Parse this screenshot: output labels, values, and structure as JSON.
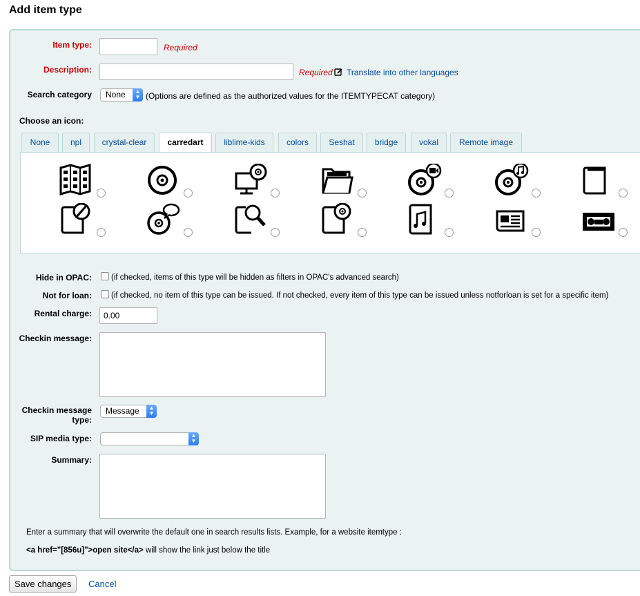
{
  "page": {
    "title": "Add item type"
  },
  "form": {
    "item_type": {
      "label": "Item type:",
      "value": "",
      "required_text": "Required"
    },
    "description": {
      "label": "Description:",
      "value": "",
      "required_text": "Required",
      "translate_link": "Translate into other languages"
    },
    "search_category": {
      "label": "Search category",
      "selected": "None",
      "note": "(Options are defined as the authorized values for the ITEMTYPECAT category)"
    },
    "choose_icon": {
      "label": "Choose an icon:"
    },
    "hide_in_opac": {
      "label": "Hide in OPAC:",
      "checked": false,
      "note": "(if checked, items of this type will be hidden as filters in OPAC's advanced search)"
    },
    "not_for_loan": {
      "label": "Not for loan:",
      "checked": false,
      "note": "(if checked, no item of this type can be issued. If not checked, every item of this type can be issued unless notforloan is set for a specific item)"
    },
    "rental_charge": {
      "label": "Rental charge:",
      "value": "0.00"
    },
    "checkin_message": {
      "label": "Checkin message:",
      "value": ""
    },
    "checkin_message_type": {
      "label_line1": "Checkin message",
      "label_line2": "type:",
      "selected": "Message"
    },
    "sip_media_type": {
      "label": "SIP media type:",
      "selected": ""
    },
    "summary": {
      "label": "Summary:",
      "value": "",
      "help_line1": "Enter a summary that will overwrite the default one in search results lists. Example, for a website itemtype :",
      "help_code": "<a href=\"[856u]\">open site</a>",
      "help_line2_rest": " will show the link just below the title"
    }
  },
  "icon_tabs": [
    {
      "label": "None"
    },
    {
      "label": "npl"
    },
    {
      "label": "crystal-clear"
    },
    {
      "label": "carredart",
      "active": true
    },
    {
      "label": "liblime-kids"
    },
    {
      "label": "colors"
    },
    {
      "label": "Seshat"
    },
    {
      "label": "bridge"
    },
    {
      "label": "vokal"
    },
    {
      "label": "Remote image"
    }
  ],
  "icons": [
    "map-icon",
    "cd-icon",
    "computer-disc-icon",
    "folder-icon",
    "video-disc-icon",
    "music-disc-icon",
    "book-icon",
    "art-book-icon",
    "speech-disc-icon",
    "book-search-icon",
    "book-disc-icon",
    "music-book-icon",
    "newspaper-icon",
    "vhs-icon"
  ],
  "buttons": {
    "save": "Save changes",
    "cancel": "Cancel"
  },
  "colors": {
    "required": "#cc0000",
    "link": "#004d99",
    "fieldset_bg": "#eaf2f2",
    "fieldset_border": "#b9d8d9"
  }
}
